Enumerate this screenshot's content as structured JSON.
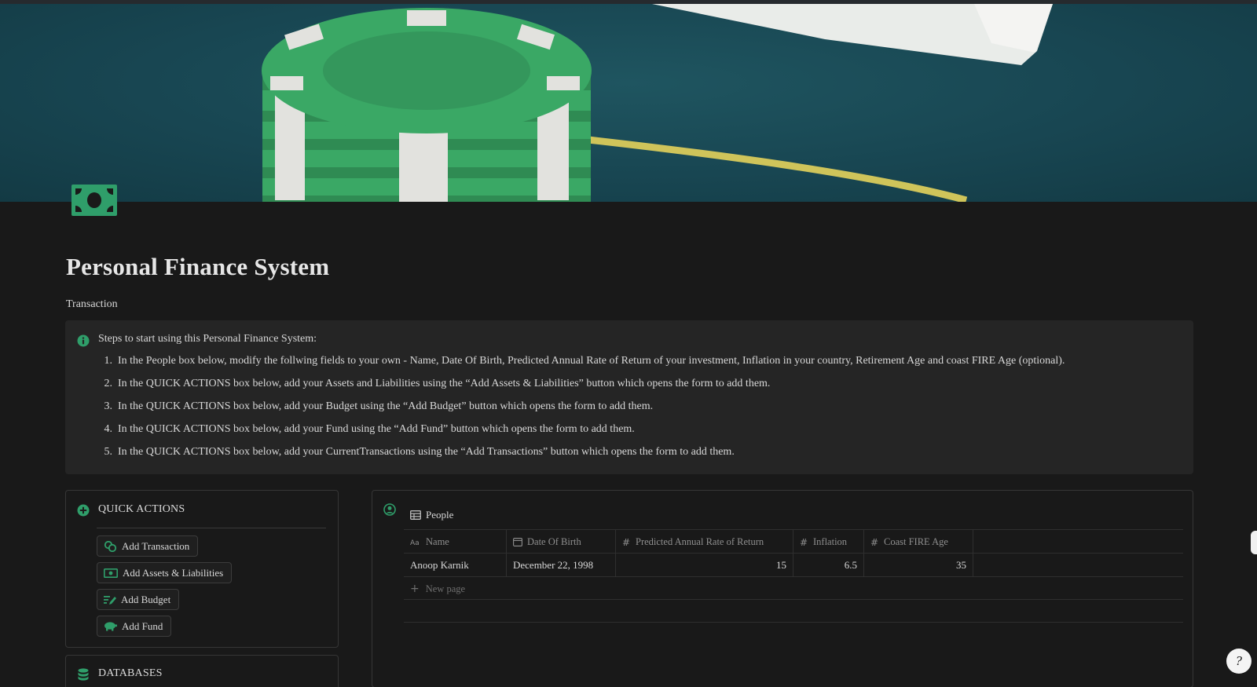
{
  "page": {
    "title": "Personal Finance System",
    "subtitle": "Transaction",
    "icon": "money-bill-icon",
    "accent_color": "#2f9e6a"
  },
  "callout": {
    "icon": "info-icon",
    "heading": "Steps to start using this Personal Finance System:",
    "steps": [
      {
        "num": "1.",
        "text": "In the People box below, modify the follwing fields to your own - Name, Date Of Birth, Predicted Annual Rate of Return of your investment, Inflation in your country, Retirement Age and coast FIRE Age (optional)."
      },
      {
        "num": "2.",
        "text": "In the QUICK ACTIONS box below, add your Assets and Liabilities using the “Add Assets & Liabilities” button which opens the form to add them."
      },
      {
        "num": "3.",
        "text": "In the QUICK ACTIONS box below, add your Budget using the “Add Budget” button which opens the form to add them."
      },
      {
        "num": "4.",
        "text": "In the QUICK ACTIONS box below, add your Fund using the “Add Fund” button which opens the form to add them."
      },
      {
        "num": "5.",
        "text": "In the QUICK ACTIONS box below, add your CurrentTransactions using the “Add Transactions” button which opens the form to add them."
      }
    ]
  },
  "quick_actions": {
    "title": "QUICK ACTIONS",
    "icon": "plus-circle-icon",
    "buttons": [
      {
        "label": "Add Transaction",
        "icon": "coins-icon"
      },
      {
        "label": "Add Assets & Liabilities",
        "icon": "money-bill-icon"
      },
      {
        "label": "Add Budget",
        "icon": "edit-list-icon"
      },
      {
        "label": "Add Fund",
        "icon": "piggy-bank-icon"
      }
    ]
  },
  "databases": {
    "title": "DATABASES",
    "icon": "database-icon"
  },
  "people": {
    "icon": "user-circle-icon",
    "db_name": "People",
    "columns": [
      {
        "label": "Name",
        "type": "title"
      },
      {
        "label": "Date Of Birth",
        "type": "date"
      },
      {
        "label": "Predicted Annual Rate of Return",
        "type": "number"
      },
      {
        "label": "Inflation",
        "type": "number"
      },
      {
        "label": "Coast FIRE Age",
        "type": "number"
      }
    ],
    "rows": [
      {
        "name": "Anoop Karnik",
        "dob": "December 22, 1998",
        "rate": "15",
        "inflation": "6.5",
        "coast_fire_age": "35"
      }
    ],
    "new_page_label": "New page"
  },
  "help": {
    "label": "?"
  }
}
